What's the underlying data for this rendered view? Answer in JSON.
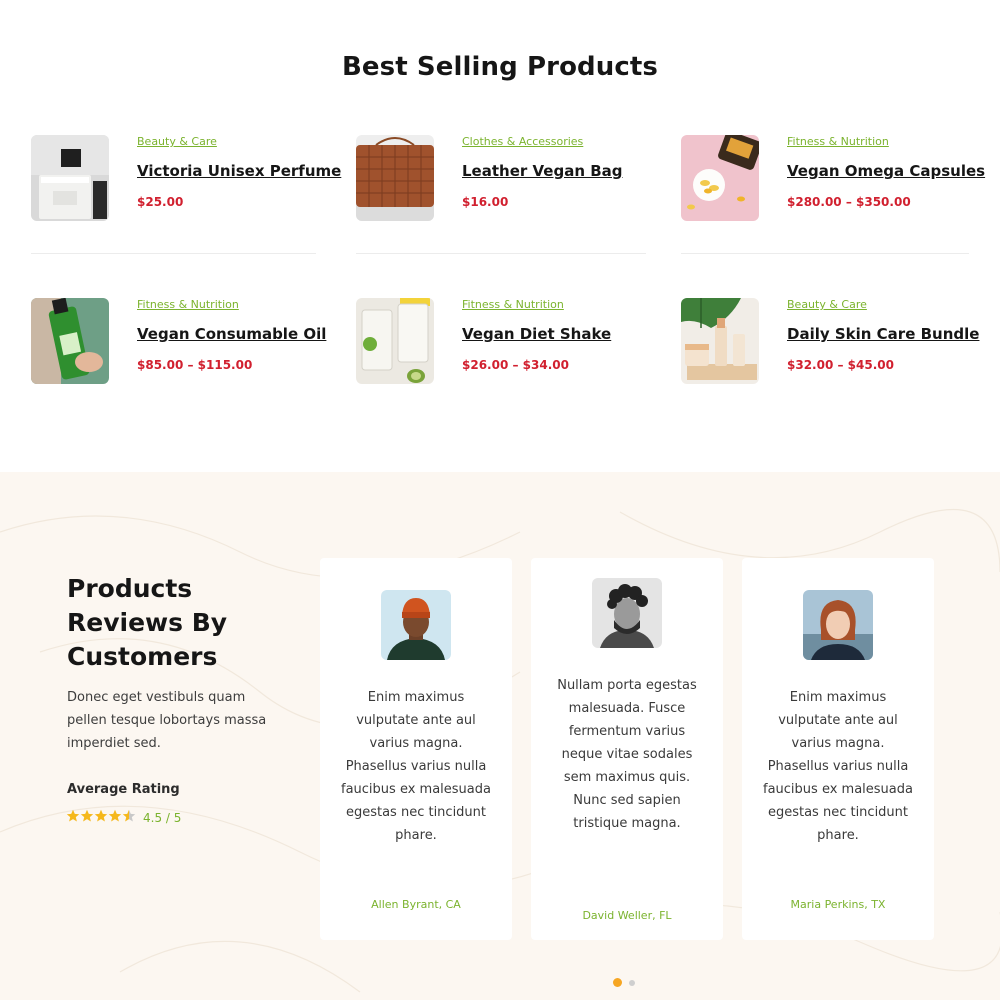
{
  "best_selling": {
    "title": "Best Selling Products",
    "products": [
      {
        "category": "Beauty & Care",
        "name": "Victoria Unisex Perfume",
        "price": "$25.00",
        "image": "perfume-bottle"
      },
      {
        "category": "Clothes & Accessories",
        "name": "Leather Vegan Bag",
        "price": "$16.00",
        "image": "woven-leather-bag"
      },
      {
        "category": "Fitness & Nutrition",
        "name": "Vegan Omega Capsules",
        "price": "$280.00 – $350.00",
        "image": "omega-capsules"
      },
      {
        "category": "Fitness & Nutrition",
        "name": "Vegan Consumable Oil",
        "price": "$85.00 – $115.00",
        "image": "green-oil-bottle"
      },
      {
        "category": "Fitness & Nutrition",
        "name": "Vegan Diet Shake",
        "price": "$26.00 – $34.00",
        "image": "diet-shake-glasses"
      },
      {
        "category": "Beauty & Care",
        "name": "Daily Skin Care Bundle",
        "price": "$32.00 – $45.00",
        "image": "skin-care-jars"
      }
    ]
  },
  "reviews": {
    "title_lines": [
      "Products",
      "Reviews By",
      "Customers"
    ],
    "description": "Donec eget vestibuls quam pellen tesque lobortays massa imperdiet sed.",
    "average_label": "Average Rating",
    "rating_value": 4.5,
    "rating_text": "4.5 / 5",
    "star_color": "#f5b81c",
    "testimonials": [
      {
        "quote": "Enim maximus vulputate ante aul varius magna. Phasellus varius nulla faucibus ex malesuada egestas nec tincidunt phare.",
        "author": "Allen Byrant, CA",
        "avatar": "man-orange-beanie"
      },
      {
        "quote": "Nullam porta egestas malesuada. Fusce fermentum varius neque vitae sodales sem maximus quis. Nunc sed sapien tristique magna.",
        "author": "David Weller, FL",
        "avatar": "man-curly-hair-bw"
      },
      {
        "quote": "Enim maximus vulputate ante aul varius magna. Phasellus varius nulla faucibus ex malesuada egestas nec tincidunt phare.",
        "author": "Maria Perkins, TX",
        "avatar": "woman-red-hair"
      }
    ],
    "carousel": {
      "pages": 2,
      "active": 1
    }
  },
  "colors": {
    "accent_green": "#7bb32e",
    "price_red": "#d1202f",
    "dot_active": "#f6a623",
    "section_bg": "#fcf7f1"
  }
}
